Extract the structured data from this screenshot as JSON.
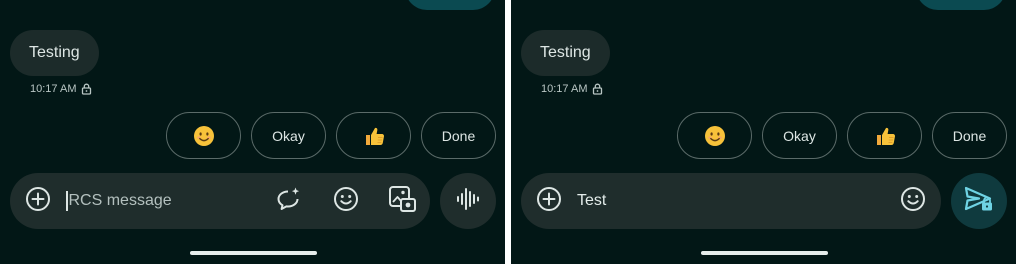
{
  "screens": [
    {
      "received_message": "Testing",
      "timestamp": "10:17 AM",
      "suggestions": [
        {
          "type": "emoji",
          "icon": "smiling-face-emoji"
        },
        {
          "type": "text",
          "label": "Okay"
        },
        {
          "type": "emoji",
          "icon": "thumbs-up-emoji"
        },
        {
          "type": "text",
          "label": "Done"
        }
      ],
      "compose": {
        "placeholder": "RCS message",
        "value": ""
      },
      "trailing_button_icon": "voice-waveform-icon"
    },
    {
      "received_message": "Testing",
      "timestamp": "10:17 AM",
      "suggestions": [
        {
          "type": "emoji",
          "icon": "smiling-face-emoji"
        },
        {
          "type": "text",
          "label": "Okay"
        },
        {
          "type": "emoji",
          "icon": "thumbs-up-emoji"
        },
        {
          "type": "text",
          "label": "Done"
        }
      ],
      "compose": {
        "placeholder": "RCS message",
        "value": "Test"
      },
      "trailing_button_icon": "send-encrypted-icon"
    }
  ],
  "colors": {
    "background": "#021716",
    "received_bubble": "#1c2b2a",
    "sent_bubble": "#0b4a51",
    "compose_bar": "#1f2d2c",
    "send_button": "#0f3a3e",
    "send_icon": "#6fd3e4"
  }
}
